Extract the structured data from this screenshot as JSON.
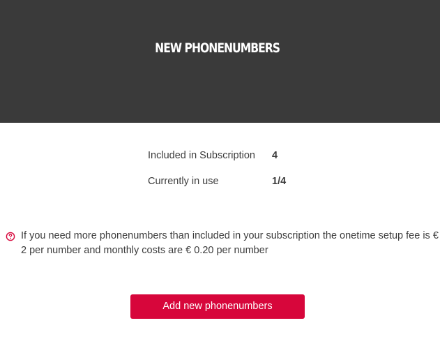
{
  "header": {
    "title": "NEW PHONENUMBERS"
  },
  "stats": [
    {
      "label": "Included in Subscription",
      "value": "4"
    },
    {
      "label": "Currently in use",
      "value": "1/4"
    }
  ],
  "notice": {
    "icon": "help-circle-icon",
    "text": "If you need more phonenumbers than included in your subscription the onetime setup fee is € 2 per number and monthly costs are € 0.20 per number"
  },
  "actions": {
    "add_label": "Add new phonenumbers"
  },
  "colors": {
    "header_bg": "#3a3a3a",
    "accent": "#d7063b"
  }
}
